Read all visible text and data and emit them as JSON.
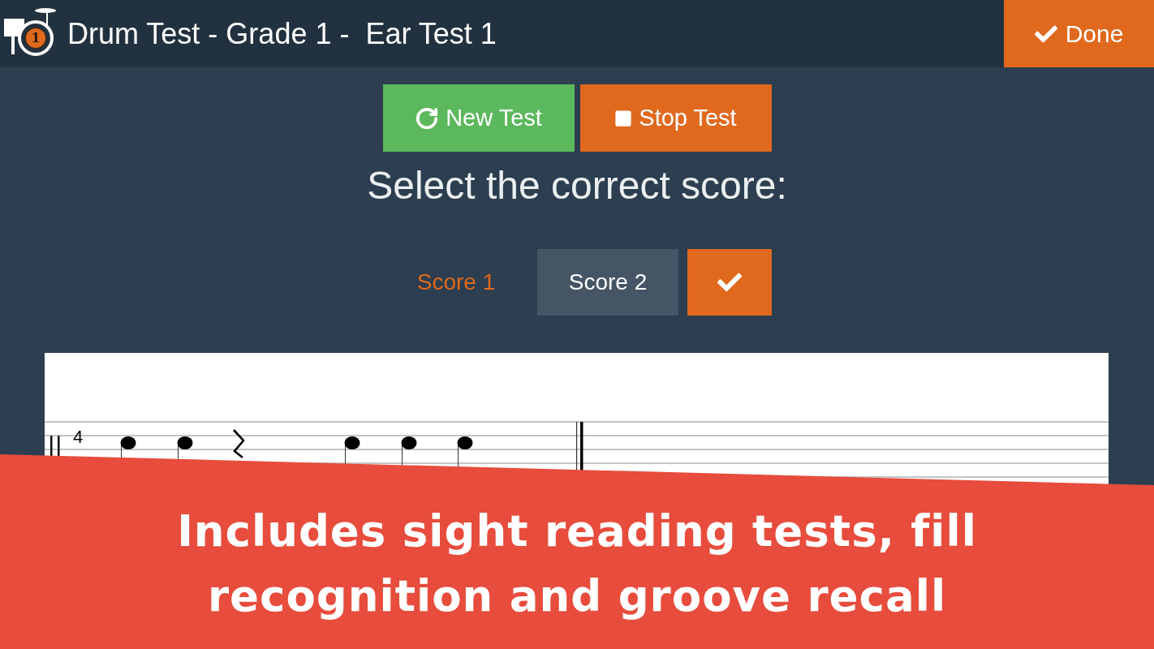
{
  "header": {
    "logo_badge": "1",
    "title": "Drum Test - Grade 1 -  Ear Test 1",
    "done_button": "Done"
  },
  "test_controls": [
    {
      "kind": "restart",
      "label": "New Test"
    },
    {
      "kind": "stop",
      "label": "Stop Test"
    }
  ],
  "prompt": "Select the correct score:",
  "score_options": [
    {
      "label": "Score 1",
      "selected": false
    },
    {
      "label": "Score 2",
      "selected": true
    }
  ],
  "score_sheet": {
    "time_signature": "4"
  },
  "promo_banner": {
    "caption": "Includes sight reading tests, fill recognition and groove recall"
  }
}
